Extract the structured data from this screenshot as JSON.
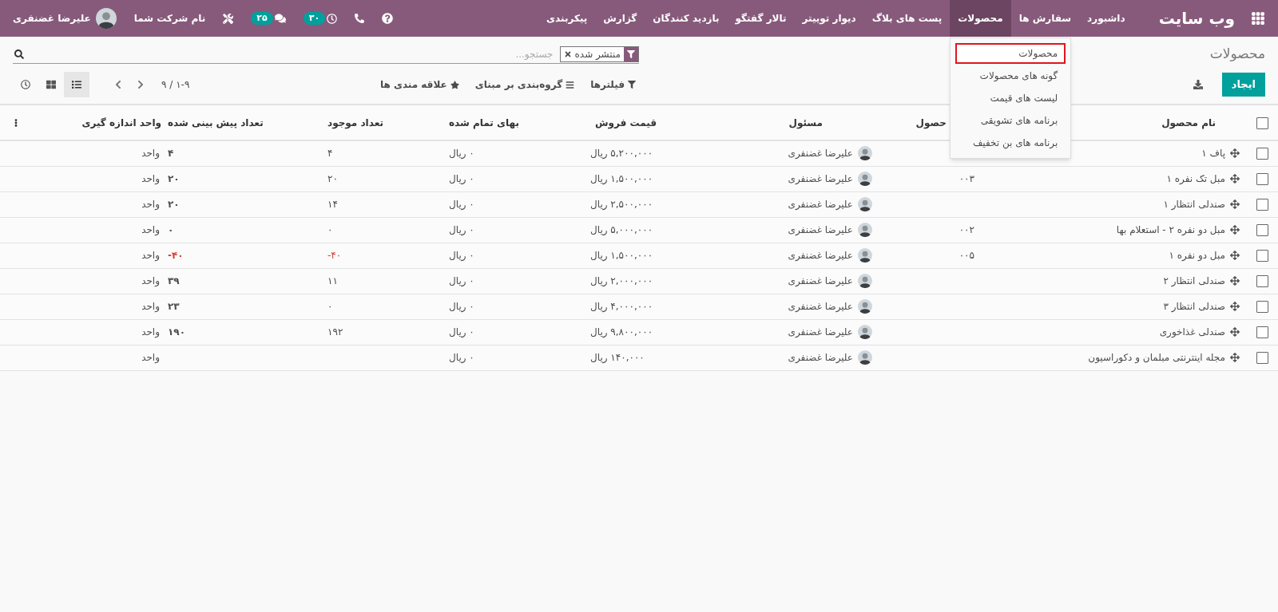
{
  "navbar": {
    "brand": "وب سایت",
    "menu": [
      {
        "label": "داشبورد",
        "selected": false
      },
      {
        "label": "سفارش ها",
        "selected": false
      },
      {
        "label": "محصولات",
        "selected": true
      },
      {
        "label": "پست های بلاگ",
        "selected": false
      },
      {
        "label": "دیوار توییتر",
        "selected": false
      },
      {
        "label": "تالار گفتگو",
        "selected": false
      },
      {
        "label": "بازدید کنندگان",
        "selected": false
      },
      {
        "label": "گزارش",
        "selected": false
      },
      {
        "label": "پیکربندی",
        "selected": false
      }
    ],
    "dropdown": [
      {
        "label": "محصولات",
        "highlighted": true
      },
      {
        "label": "گونه های محصولات",
        "highlighted": false
      },
      {
        "label": "لیست های قیمت",
        "highlighted": false
      },
      {
        "label": "برنامه های تشویقی",
        "highlighted": false
      },
      {
        "label": "برنامه های بن تخفیف",
        "highlighted": false
      }
    ],
    "systray": {
      "activity_count": "۳۰",
      "message_count": "۲۵",
      "company": "نام شرکت شما",
      "user": "علیرضا غضنفری"
    }
  },
  "control_panel": {
    "breadcrumb": "محصولات",
    "create_button": "ایجاد",
    "search": {
      "facet": "منتشر شده",
      "placeholder": "جستجو..."
    },
    "filters": "فیلترها",
    "group_by": "گروه‌بندی بر مبنای",
    "favorites": "علاقه مندی ها",
    "pager": "۱-۹ / ۹",
    "views": [
      {
        "kind": "list",
        "selected": true
      },
      {
        "kind": "kanban",
        "selected": false
      },
      {
        "kind": "activity",
        "selected": false
      }
    ]
  },
  "table": {
    "columns": [
      "نام محصول",
      "حصول",
      "مسئول",
      "قیمت فروش",
      "بهای تمام شده",
      "تعداد موجود",
      "تعداد پیش بینی شده",
      "واحد اندازه گیری"
    ],
    "all_checked": false,
    "rows": [
      {
        "checked": false,
        "name": "پاف ۱",
        "responsible": "علیرضا غضنفری",
        "price": "۵,۲۰۰,۰۰۰ ریال",
        "cost": "۰ ریال",
        "on_hand": "۴",
        "forecast": "۴",
        "uom": "واحد",
        "negative": false
      },
      {
        "checked": false,
        "name": "مبل تک نفره ۱",
        "reference": "۰۰۳",
        "responsible": "علیرضا غضنفری",
        "price": "۱,۵۰۰,۰۰۰ ریال",
        "cost": "۰ ریال",
        "on_hand": "۲۰",
        "forecast": "۲۰",
        "uom": "واحد",
        "negative": false
      },
      {
        "checked": false,
        "name": "صندلی انتظار ۱",
        "responsible": "علیرضا غضنفری",
        "price": "۲,۵۰۰,۰۰۰ ریال",
        "cost": "۰ ریال",
        "on_hand": "۱۴",
        "forecast": "۲۰",
        "uom": "واحد",
        "negative": false
      },
      {
        "checked": false,
        "name": "مبل دو نفره ۲ - استعلام بها",
        "reference": "۰۰۲",
        "responsible": "علیرضا غضنفری",
        "price": "۵,۰۰۰,۰۰۰ ریال",
        "cost": "۰ ریال",
        "on_hand": "۰",
        "forecast": "۰",
        "uom": "واحد",
        "negative": false
      },
      {
        "checked": false,
        "name": "مبل دو نفره ۱",
        "reference": "۰۰۵",
        "responsible": "علیرضا غضنفری",
        "price": "۱,۵۰۰,۰۰۰ ریال",
        "cost": "۰ ریال",
        "on_hand": "۴۰-",
        "forecast": "۴۰-",
        "uom": "واحد",
        "negative": true
      },
      {
        "checked": false,
        "name": "صندلی انتظار ۲",
        "responsible": "علیرضا غضنفری",
        "price": "۲,۰۰۰,۰۰۰ ریال",
        "cost": "۰ ریال",
        "on_hand": "۱۱",
        "forecast": "۳۹",
        "uom": "واحد",
        "negative": false
      },
      {
        "checked": false,
        "name": "صندلی انتظار ۳",
        "responsible": "علیرضا غضنفری",
        "price": "۴,۰۰۰,۰۰۰ ریال",
        "cost": "۰ ریال",
        "on_hand": "۰",
        "forecast": "۲۳",
        "uom": "واحد",
        "negative": false
      },
      {
        "checked": false,
        "name": "صندلی غذاخوری",
        "responsible": "علیرضا غضنفری",
        "price": "۹,۸۰۰,۰۰۰ ریال",
        "cost": "۰ ریال",
        "on_hand": "۱۹۲",
        "forecast": "۱۹۰",
        "uom": "واحد",
        "negative": false
      },
      {
        "checked": false,
        "name": "مجله اینترنتی مبلمان و دکوراسیون",
        "responsible": "علیرضا غضنفری",
        "price": "۱۴۰,۰۰۰ ریال",
        "cost": "۰ ریال",
        "uom": "واحد"
      }
    ]
  }
}
